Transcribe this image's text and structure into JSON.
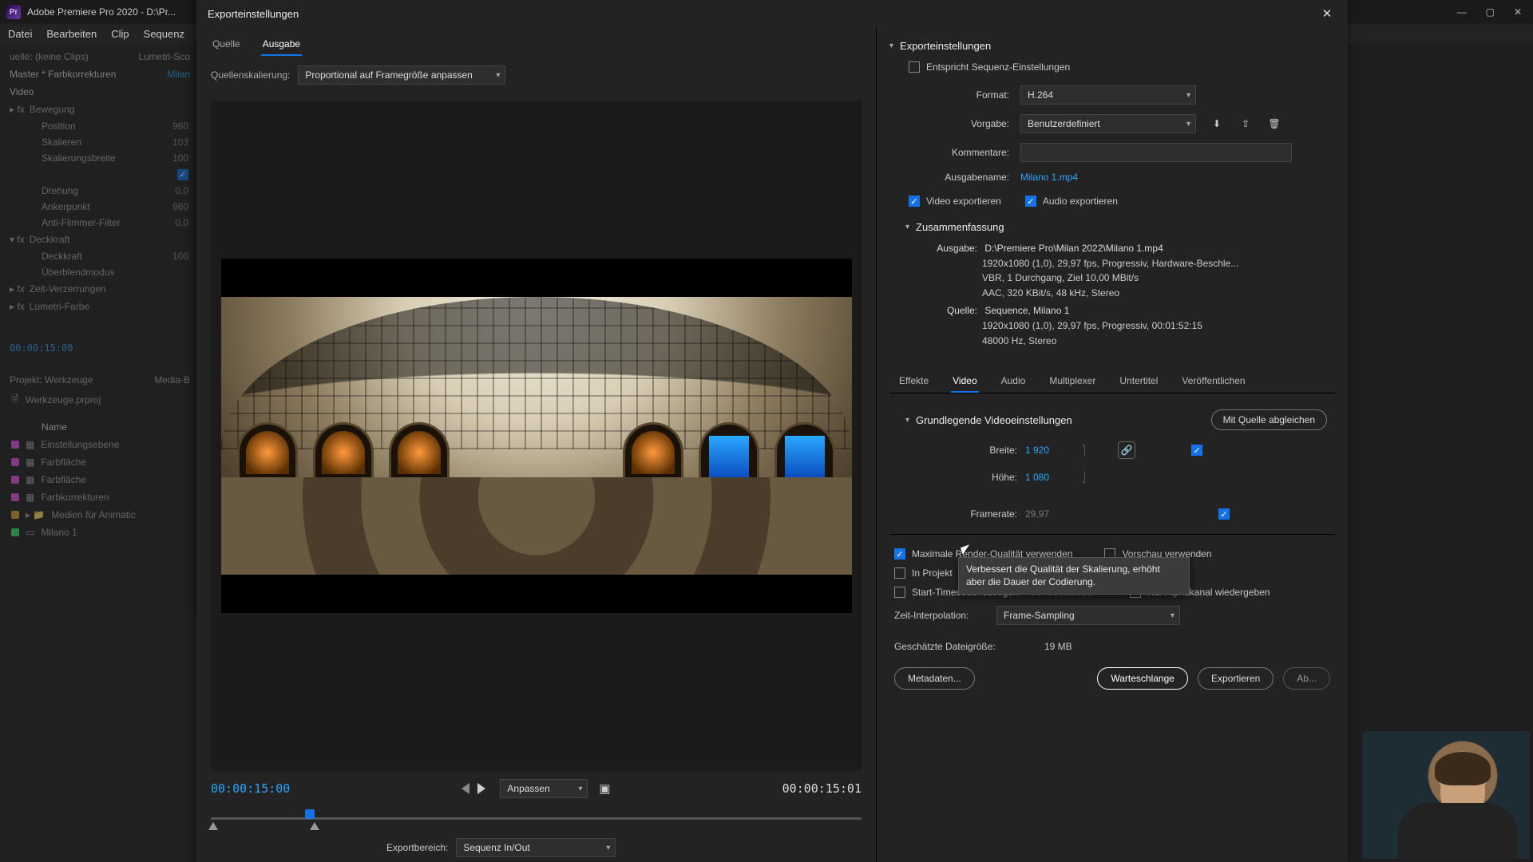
{
  "app": {
    "title": "Adobe Premiere Pro 2020 - D:\\Pr...",
    "menu": [
      "Datei",
      "Bearbeiten",
      "Clip",
      "Sequenz"
    ]
  },
  "left_panel": {
    "tabs": [
      "uelle: (keine Clips)",
      "Lumetri-Sco"
    ],
    "crumb_left": "Master * Farbkorrekturen",
    "crumb_right": "Milan",
    "section": "Video",
    "props": [
      {
        "group": "Bewegung",
        "items": [
          {
            "name": "Position",
            "val": "960"
          },
          {
            "name": "Skalieren",
            "val": "103"
          },
          {
            "name": "Skalierungsbreite",
            "val": "100"
          },
          {
            "name": "",
            "val": ""
          },
          {
            "name": "Drehung",
            "val": "0,0"
          },
          {
            "name": "Ankerpunkt",
            "val": "960"
          },
          {
            "name": "Anti-Flimmer-Filter",
            "val": "0,0"
          }
        ]
      },
      {
        "group": "Deckkraft",
        "items": [
          {
            "name": "Deckkraft",
            "val": "100"
          },
          {
            "name": "Überblendmodus",
            "val": ""
          }
        ]
      },
      {
        "group": "Zeit-Verzerrungen",
        "items": []
      },
      {
        "group": "Lumetri-Farbe",
        "items": []
      }
    ],
    "timecode": "00:00:15:00",
    "project_tabs": [
      "Projekt: Werkzeuge",
      "Media-B"
    ],
    "project_file": "Werkzeuge.prproj",
    "col_name": "Name",
    "items": [
      {
        "color": "#e657e6",
        "icon": "fx",
        "label": "Einstellungsebene"
      },
      {
        "color": "#e657e6",
        "icon": "img",
        "label": "Farbfläche"
      },
      {
        "color": "#e657e6",
        "icon": "img",
        "label": "Farbfläche"
      },
      {
        "color": "#e657e6",
        "icon": "fx",
        "label": "Farbkorrekturen"
      },
      {
        "color": "#e6a23c",
        "icon": "bin",
        "label": "Medien für Animatic"
      },
      {
        "color": "#3ce67a",
        "icon": "seq",
        "label": "Milano 1"
      }
    ]
  },
  "dialog": {
    "title": "Exporteinstellungen",
    "tabs": {
      "source": "Quelle",
      "output": "Ausgabe"
    },
    "scale_label": "Quellenskalierung:",
    "scale_value": "Proportional auf Framegröße anpassen",
    "tc_in": "00:00:15:00",
    "tc_out": "00:00:15:01",
    "fit": "Anpassen",
    "range_label": "Exportbereich:",
    "range_value": "Sequenz In/Out"
  },
  "export": {
    "heading": "Exporteinstellungen",
    "match_seq": "Entspricht Sequenz-Einstellungen",
    "format_label": "Format:",
    "format_value": "H.264",
    "preset_label": "Vorgabe:",
    "preset_value": "Benutzerdefiniert",
    "comments_label": "Kommentare:",
    "outputname_label": "Ausgabename:",
    "outputname_value": "Milano 1.mp4",
    "export_video": "Video exportieren",
    "export_audio": "Audio exportieren",
    "summary_heading": "Zusammenfassung",
    "summary": {
      "output_label": "Ausgabe:",
      "output_lines": [
        "D:\\Premiere Pro\\Milan 2022\\Milano 1.mp4",
        "1920x1080 (1,0), 29,97 fps, Progressiv, Hardware-Beschle...",
        "VBR, 1 Durchgang, Ziel 10,00 MBit/s",
        "AAC, 320 KBit/s, 48 kHz, Stereo"
      ],
      "source_label": "Quelle:",
      "source_lines": [
        "Sequence, Milano 1",
        "1920x1080 (1,0), 29,97 fps, Progressiv, 00:01:52:15",
        "48000 Hz, Stereo"
      ]
    },
    "tabs": [
      "Effekte",
      "Video",
      "Audio",
      "Multiplexer",
      "Untertitel",
      "Veröffentlichen"
    ],
    "video": {
      "heading": "Grundlegende Videoeinstellungen",
      "match": "Mit Quelle abgleichen",
      "width_label": "Breite:",
      "width": "1 920",
      "height_label": "Höhe:",
      "height": "1 080",
      "fps_label": "Framerate:",
      "fps": "29,97"
    },
    "bottom": {
      "max_quality": "Maximale Render-Qualität verwenden",
      "use_preview": "Vorschau verwenden",
      "import_project": "In Projekt",
      "set_start_tc": "Start-Timecode festlegen",
      "start_tc_value": "00:00:00:00",
      "alpha_only": "Nur Alphakanal wiedergeben",
      "interp_label": "Zeit-Interpolation:",
      "interp_value": "Frame-Sampling",
      "est_label": "Geschätzte Dateigröße:",
      "est_value": "19 MB",
      "tooltip": "Verbessert die Qualität der Skalierung, erhöht aber die Dauer der Codierung."
    },
    "buttons": {
      "metadata": "Metadaten...",
      "queue": "Warteschlange",
      "export": "Exportieren",
      "cancel": "Ab..."
    }
  }
}
